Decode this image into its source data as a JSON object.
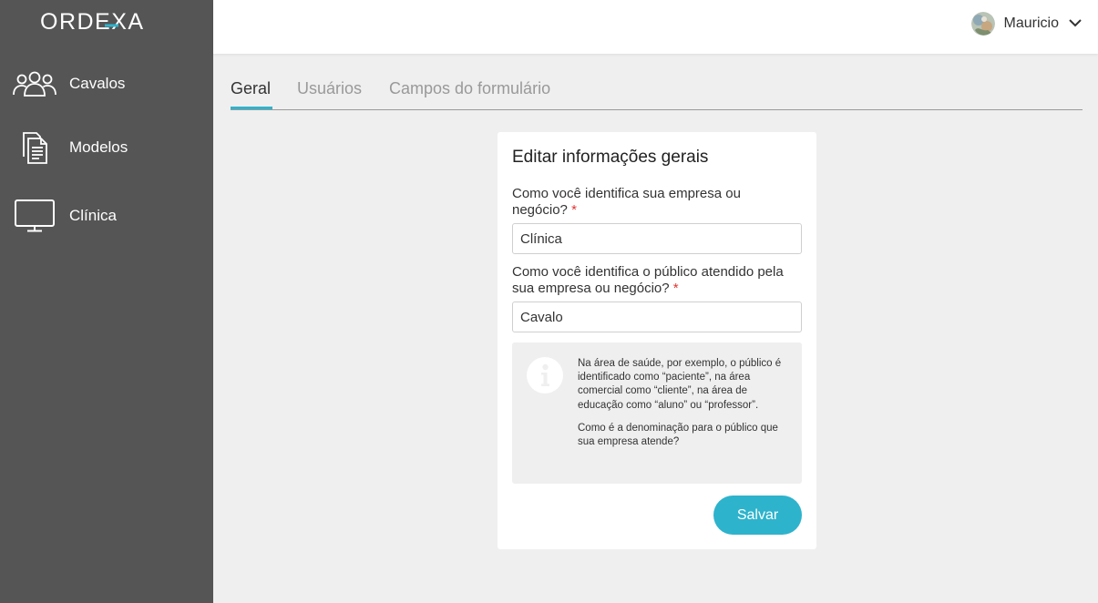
{
  "app": {
    "logo_text": "ORDEXA",
    "accent_color": "#2eb3cc",
    "sidebar_color": "#555555"
  },
  "sidebar": {
    "items": [
      {
        "label": "Cavalos",
        "icon": "users-group-icon"
      },
      {
        "label": "Modelos",
        "icon": "documents-icon"
      },
      {
        "label": "Clínica",
        "icon": "monitor-icon"
      }
    ]
  },
  "header": {
    "user_name": "Mauricio",
    "menu_icon": "chevron-down-icon"
  },
  "tabs": [
    {
      "label": "Geral",
      "active": true
    },
    {
      "label": "Usuários",
      "active": false
    },
    {
      "label": "Campos do formulário",
      "active": false
    }
  ],
  "form": {
    "title": "Editar informações gerais",
    "fields": [
      {
        "label": "Como você identifica sua empresa ou negócio?",
        "required_mark": "*",
        "value": "Clínica"
      },
      {
        "label": "Como você identifica o público atendido pela sua empresa ou negócio?",
        "required_mark": "*",
        "value": "Cavalo"
      }
    ],
    "info": {
      "icon": "info-icon",
      "paragraph_1": "Na área de saúde, por exemplo, o público é identificado como “paciente”, na área comercial como “cliente”, na área de educação como “aluno” ou “professor”.",
      "paragraph_2": "Como é a denominação para o público que sua empresa atende?"
    },
    "save_label": "Salvar"
  }
}
